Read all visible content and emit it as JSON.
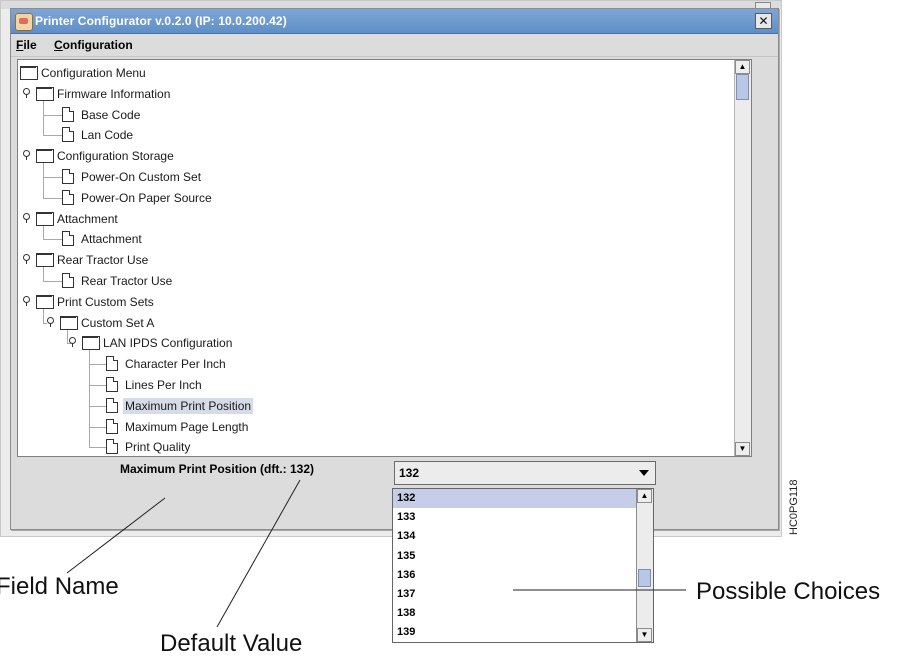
{
  "window": {
    "title": "Printer Configurator v.0.2.0 (IP: 10.0.200.42)",
    "close_glyph": "✕"
  },
  "menubar": {
    "file_label": "File",
    "file_mnemonic": "F",
    "file_rest": "ile",
    "configuration_label": "Configuration",
    "configuration_mnemonic": "C",
    "configuration_rest": "onfiguration"
  },
  "tree": {
    "nodes": [
      {
        "label": "Configuration Menu",
        "type": "folder",
        "level": 0,
        "expandable": false
      },
      {
        "label": "Firmware Information",
        "type": "folder",
        "level": 0,
        "expandable": true
      },
      {
        "label": "Base Code",
        "type": "file",
        "level": 1
      },
      {
        "label": "Lan Code",
        "type": "file",
        "level": 1
      },
      {
        "label": "Configuration Storage",
        "type": "folder",
        "level": 0,
        "expandable": true
      },
      {
        "label": "Power-On Custom Set",
        "type": "file",
        "level": 1
      },
      {
        "label": "Power-On Paper Source",
        "type": "file",
        "level": 1
      },
      {
        "label": "Attachment",
        "type": "folder",
        "level": 0,
        "expandable": true
      },
      {
        "label": "Attachment",
        "type": "file",
        "level": 1
      },
      {
        "label": "Rear Tractor Use",
        "type": "folder",
        "level": 0,
        "expandable": true
      },
      {
        "label": "Rear Tractor Use",
        "type": "file",
        "level": 1
      },
      {
        "label": "Print Custom Sets",
        "type": "folder",
        "level": 0,
        "expandable": true
      },
      {
        "label": "Custom Set A",
        "type": "folder",
        "level": 1,
        "expandable": true
      },
      {
        "label": "LAN IPDS Configuration",
        "type": "folder",
        "level": 2,
        "expandable": true
      },
      {
        "label": "Character Per Inch",
        "type": "file",
        "level": 3
      },
      {
        "label": "Lines Per Inch",
        "type": "file",
        "level": 3
      },
      {
        "label": "Maximum Print Position",
        "type": "file",
        "level": 3,
        "selected": true
      },
      {
        "label": "Maximum Page Length",
        "type": "file",
        "level": 3
      },
      {
        "label": "Print Quality",
        "type": "file",
        "level": 3
      }
    ],
    "scrollbar": {
      "position": 0.0
    }
  },
  "detail": {
    "field_label": "Maximum Print Position (dft.: 132)"
  },
  "combo": {
    "value": "132",
    "options": [
      "132",
      "133",
      "134",
      "135",
      "136",
      "137",
      "138",
      "139"
    ],
    "selected_index": 0
  },
  "annotations": {
    "field_name": "Field Name",
    "default_value": "Default Value",
    "possible_choices": "Possible Choices",
    "figure_code": "HC0PG118"
  },
  "colors": {
    "title_bar": "#6b97cc",
    "selection": "#c5cde8",
    "window_bg": "#dcdcdc"
  }
}
